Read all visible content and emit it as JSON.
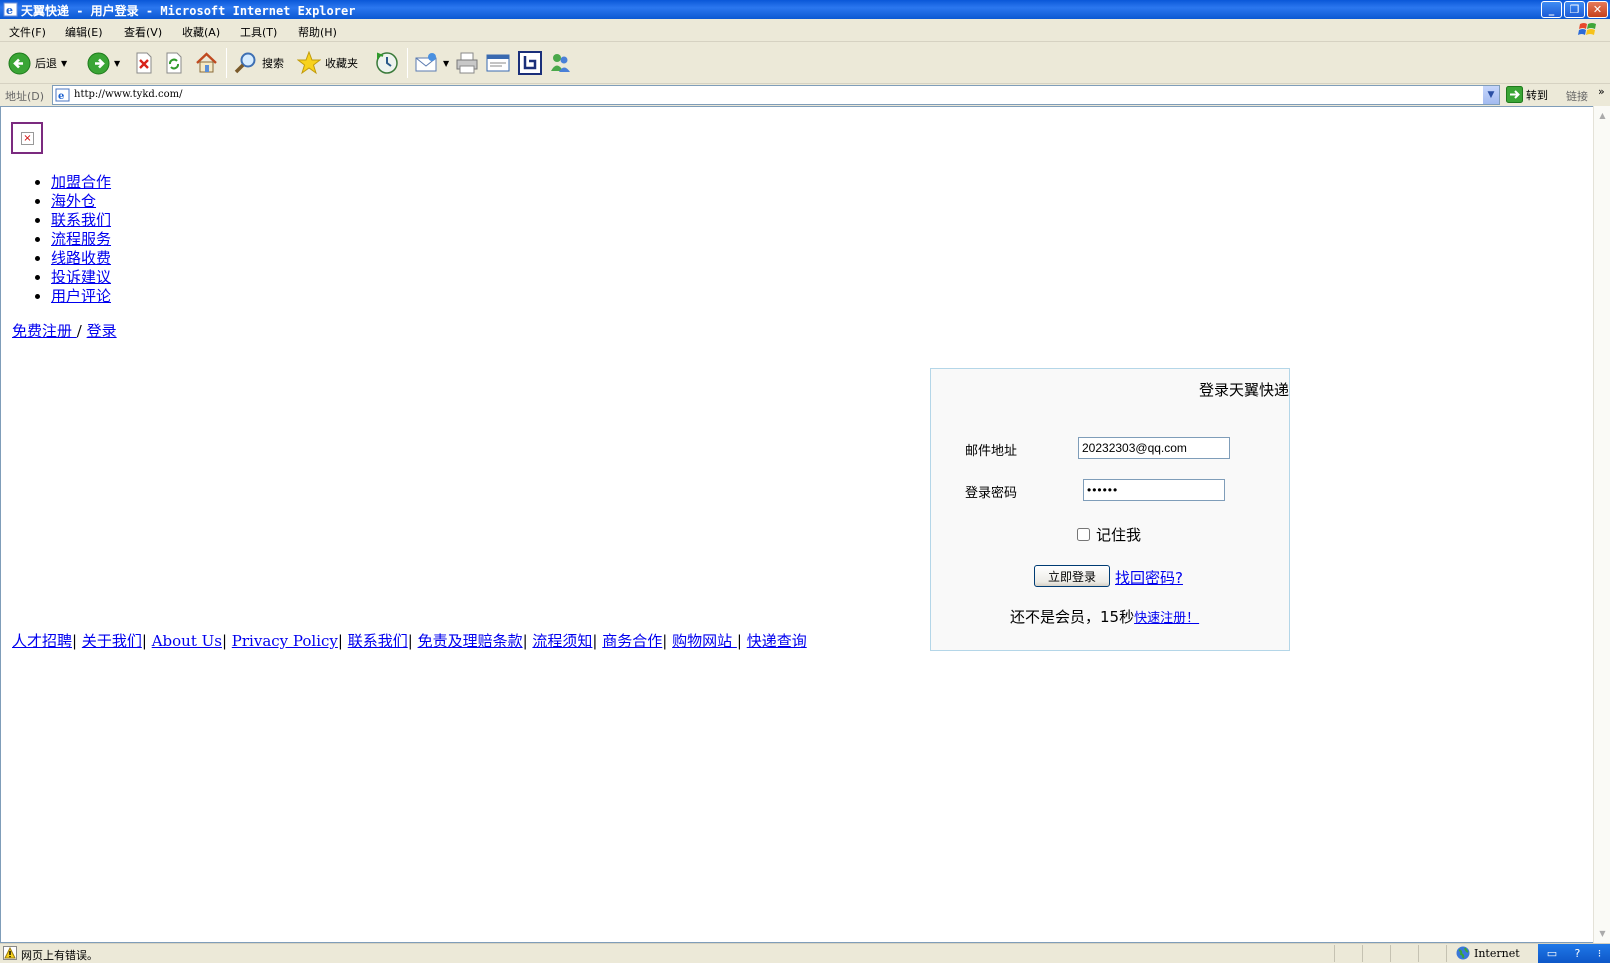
{
  "window": {
    "title": "天翼快递 - 用户登录 - Microsoft Internet Explorer",
    "minimize": "_",
    "restore": "❐",
    "close": "✕"
  },
  "menu": [
    "文件(F)",
    "编辑(E)",
    "查看(V)",
    "收藏(A)",
    "工具(T)",
    "帮助(H)"
  ],
  "toolbar": {
    "back_label": "后退",
    "search_label": "搜索",
    "favorites_label": "收藏夹"
  },
  "address": {
    "label": "地址(D)",
    "url": "http://www.tykd.com/",
    "go_label": "转到",
    "links_label": "链接"
  },
  "page": {
    "nav_items": [
      "加盟合作",
      "海外仓",
      "联系我们",
      "流程服务",
      "线路收费",
      "投诉建议",
      "用户评论"
    ],
    "register_link": " 免费注册 ",
    "separator": "/",
    "login_link": "登录",
    "login_box": {
      "title": "登录天翼快递",
      "email_label": "邮件地址",
      "email_value": "20232303@qq.com",
      "password_label": "登录密码",
      "password_value": "••••••",
      "remember_label": "记住我",
      "submit_label": "立即登录",
      "forgot_link": "找回密码?",
      "not_member_text": "还不是会员，15秒",
      "quick_register_link": "快速注册！"
    },
    "footer_links": [
      "人才招聘",
      "关于我们",
      "About Us",
      "Privacy Policy",
      "联系我们",
      "免责及理赔条款",
      "流程须知",
      "商务合作",
      "购物网站 ",
      "快递查询"
    ]
  },
  "status": {
    "message": "网页上有错误。",
    "zone": "Internet"
  }
}
